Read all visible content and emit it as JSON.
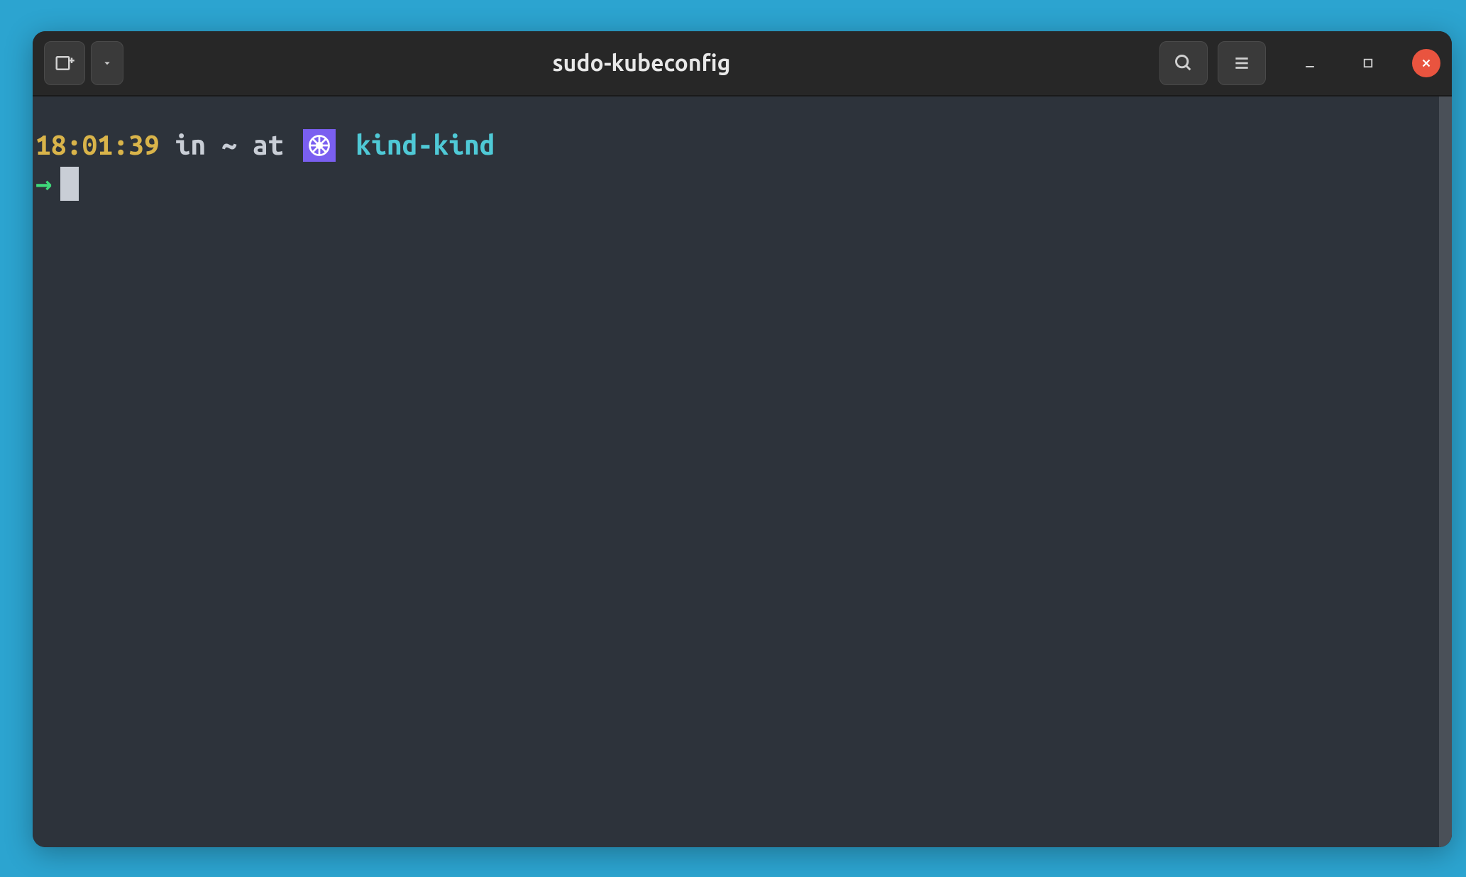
{
  "window": {
    "title": "sudo-kubeconfig"
  },
  "prompt": {
    "timestamp": "18:01:39",
    "in_word": "in",
    "path": "~",
    "at_word": "at",
    "context": "kind-kind",
    "arrow": "→"
  },
  "colors": {
    "desktop_bg": "#2ca4d0",
    "terminal_bg": "#2d333b",
    "titlebar_bg": "#272727",
    "timestamp": "#d9b44a",
    "keyword": "#c9ced6",
    "context": "#4fc9d6",
    "arrow": "#3fd97a",
    "k8s_badge": "#7a5ff0",
    "close_btn": "#e9543f"
  }
}
